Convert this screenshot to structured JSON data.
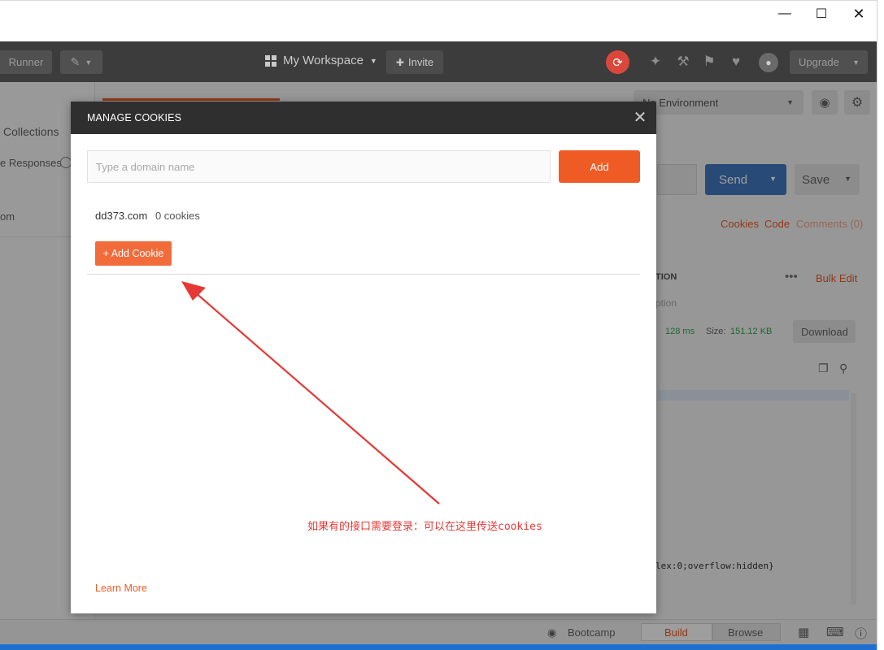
{
  "header": {
    "runner_label": "Runner",
    "workspace_label": "My Workspace",
    "invite_label": "Invite",
    "upgrade_label": "Upgrade"
  },
  "background": {
    "collections_tab": "Collections",
    "responses_label": "e Responses",
    "sidebar_item": "om",
    "environment_label": "No Environment",
    "send_label": "Send",
    "save_label": "Save",
    "cookies_link": "Cookies",
    "code_link": "Code",
    "comments_link": "Comments (0)",
    "column_header": "TION",
    "bulk_edit_label": "Bulk Edit",
    "row_placeholder": "ption",
    "time_value": "128 ms",
    "size_label": "Size:",
    "size_value": "151.12 KB",
    "download_label": "Download",
    "code_fragment": "lex:0;overflow:hidden}",
    "bootcamp_label": "Bootcamp",
    "build_tab": "Build",
    "browse_tab": "Browse"
  },
  "modal": {
    "title": "MANAGE COOKIES",
    "domain_placeholder": "Type a domain name",
    "add_label": "Add",
    "domain_name": "dd373.com",
    "cookie_count": "0 cookies",
    "add_cookie_label": "+ Add Cookie",
    "learn_more_label": "Learn More"
  },
  "annotation": {
    "text": "如果有的接口需要登录：可以在这里传送cookies",
    "color": "#e53935"
  },
  "colors": {
    "accent": "#ef5b25",
    "header_bg": "#3c3c3c",
    "modal_header_bg": "#2f2f2f",
    "send_blue": "#3f78c1"
  }
}
